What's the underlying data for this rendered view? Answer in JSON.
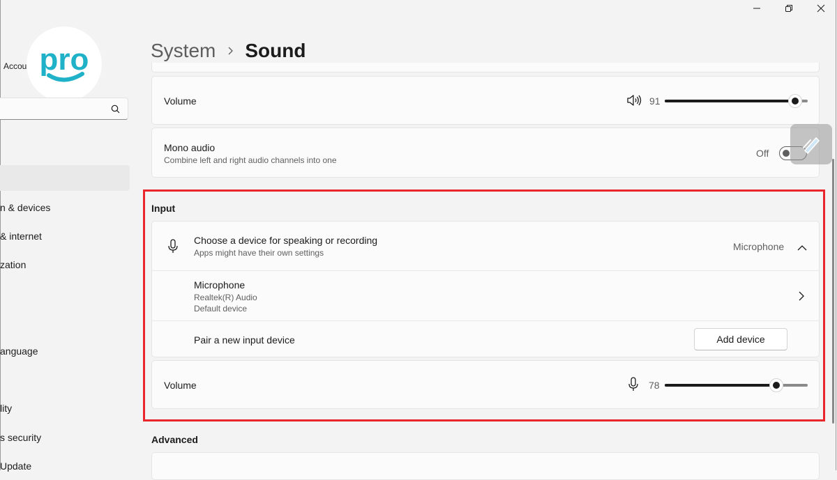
{
  "window": {
    "controls": [
      "minimize-icon",
      "restore-icon",
      "close-icon"
    ]
  },
  "sidebar": {
    "logo_text": "pro",
    "account_text": "Accou",
    "search": {
      "placeholder": "",
      "icon": "search-icon"
    },
    "items": [
      {
        "label": "n & devices"
      },
      {
        "label": "& internet"
      },
      {
        "label": "zation"
      },
      {
        "label": "anguage"
      },
      {
        "label": "lity"
      },
      {
        "label": "s security"
      },
      {
        "label": "Update"
      }
    ]
  },
  "header": {
    "parent": "System",
    "current": "Sound"
  },
  "output": {
    "volume": {
      "label": "Volume",
      "value": "91",
      "level": 91,
      "icon": "speaker-icon"
    },
    "mono": {
      "label": "Mono audio",
      "description": "Combine left and right audio channels into one",
      "state": "Off",
      "on": false
    }
  },
  "input": {
    "title": "Input",
    "choose": {
      "label": "Choose a device for speaking or recording",
      "description": "Apps might have their own settings",
      "selected": "Microphone",
      "icon": "microphone-icon"
    },
    "device": {
      "name": "Microphone",
      "driver": "Realtek(R) Audio",
      "status": "Default device"
    },
    "pair": {
      "label": "Pair a new input device",
      "button": "Add device"
    },
    "volume": {
      "label": "Volume",
      "value": "78",
      "level": 78,
      "icon": "microphone-icon"
    }
  },
  "advanced": {
    "title": "Advanced"
  },
  "colors": {
    "highlight": "#e8262c",
    "logo": "#1fb1c8"
  }
}
